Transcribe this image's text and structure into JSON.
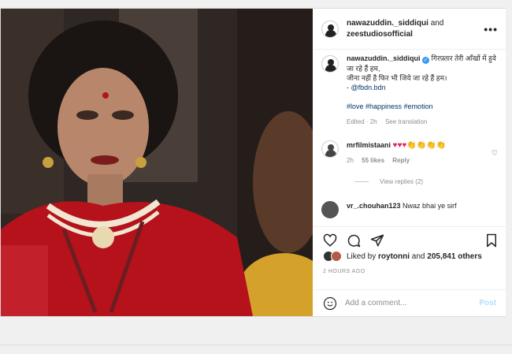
{
  "header": {
    "user1": "nawazuddin._siddiqui",
    "and": "and",
    "user2": "zeestudiosofficial",
    "more": "•••"
  },
  "caption": {
    "username": "nawazuddin._siddiqui",
    "line1": "गिरफ़्तार तेरी आँखों में हुवे जा रहे हैं हम,",
    "line2": "जीना नहीं है फिर भी जिये जा रहे हैं हम।",
    "credit_prefix": "- ",
    "credit": "@fbdn.bdn",
    "tags": "#love #happiness #emotion",
    "edited": "Edited · 2h",
    "see_translation": "See translation"
  },
  "comment": {
    "username": "mrfilmistaani",
    "hearts": "♥♥♥",
    "claps": "👏👏👏👏",
    "time": "2h",
    "likes": "55 likes",
    "reply": "Reply",
    "view_replies": "View replies (2)"
  },
  "comment3": {
    "username": "vr_.chouhan123",
    "text": "Nwaz bhai ye sirf"
  },
  "likes": {
    "prefix": "Liked by ",
    "user": "roytonni",
    "middle": " and ",
    "count": "205,841 others"
  },
  "timestamp": "2 HOURS AGO",
  "add_comment": {
    "placeholder": "Add a comment...",
    "post": "Post"
  },
  "colors": {
    "verified": "#3897f0",
    "link": "#00376b",
    "post_button": "#b2dffc",
    "heart": "#e0245e"
  }
}
